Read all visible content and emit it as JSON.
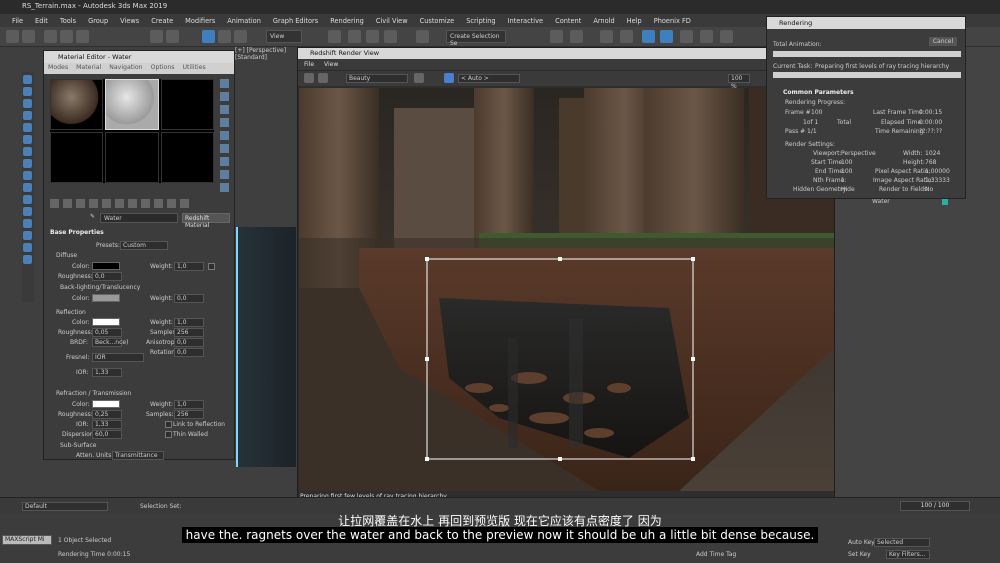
{
  "window": {
    "title": "RS_Terrain.max - Autodesk 3ds Max 2019"
  },
  "menubar": [
    "File",
    "Edit",
    "Tools",
    "Group",
    "Views",
    "Create",
    "Modifiers",
    "Animation",
    "Graph Editors",
    "Rendering",
    "Civil View",
    "Customize",
    "Scripting",
    "Interactive",
    "Content",
    "Arnold",
    "Help",
    "Phoenix FD"
  ],
  "toolbar": {
    "view_dropdown": "View",
    "selection_set": "Create Selection Se"
  },
  "viewport": {
    "label": "[+] [Perspective] [Standard]"
  },
  "material_editor": {
    "title": "Material Editor - Water",
    "menu": [
      "Modes",
      "Material",
      "Navigation",
      "Options",
      "Utilities"
    ],
    "material_name": "Water",
    "material_type": "Redshift Material",
    "base_properties": {
      "header": "Base Properties",
      "preset_label": "Presets:",
      "preset_value": "Custom",
      "diffuse": "Diffuse",
      "color_label": "Color:",
      "weight_label": "Weight:",
      "diffuse_weight": "1,0",
      "roughness_label": "Roughness:",
      "diffuse_roughness": "0,0",
      "backlighting": "Back-lighting/Translucency",
      "back_weight": "0,0",
      "reflection": "Reflection",
      "refl_roughness": "0,05",
      "samples_label": "Samples:",
      "refl_samples": "256",
      "brdf_label": "BRDF:",
      "brdf_value": "Beck...nce)",
      "anisotropy_label": "Anisotropy:",
      "anisotropy": "0,0",
      "rotation_label": "Rotation:",
      "rotation": "0,0",
      "fresnel_label": "Fresnel:",
      "fresnel_value": "IOR",
      "ior_label": "IOR:",
      "ior": "1,33",
      "refraction": "Refraction / Transmission",
      "refr_weight": "1,0",
      "refr_roughness": "0,25",
      "refr_samples": "256",
      "refr_ior": "1,33",
      "link_reflection": "Link to Reflection",
      "dispersion_label": "Dispersion:",
      "dispersion": "60,0",
      "thin_walled": "Thin Walled",
      "subsurface": "Sub-Surface",
      "atten_label": "Atten. Units:",
      "atten_value": "Transmittance"
    }
  },
  "render_view": {
    "title": "Redshift Render View",
    "menu": [
      "File",
      "View"
    ],
    "aov": "Beauty",
    "camera": "< Auto >",
    "zoom": "100 %",
    "status": "Preparing first few levels of ray tracing hierarchy"
  },
  "rendering_dialog": {
    "title": "Rendering",
    "cancel": "Cancel",
    "total_animation": "Total Animation:",
    "current_task_label": "Current Task:",
    "current_task": "Preparing first levels of ray tracing hierarchy",
    "common_parameters": "Common Parameters",
    "rendering_progress": "Rendering Progress:",
    "frame_label": "Frame #",
    "frame": "100",
    "of": "1of 1",
    "total": "Total",
    "pass_label": "Pass #",
    "pass": "1/1",
    "last_frame_time_label": "Last Frame Time:",
    "last_frame_time": "0:00:15",
    "elapsed_label": "Elapsed Time:",
    "elapsed": "0:00:00",
    "remaining_label": "Time Remaining:",
    "remaining": "??:??:??",
    "render_settings": "Render Settings:",
    "viewport_label": "Viewport:",
    "viewport": "Perspective",
    "start_label": "Start Time:",
    "start": "100",
    "end_label": "End Time:",
    "end": "100",
    "nth_label": "Nth Frame:",
    "nth": "1",
    "hidden_label": "Hidden Geometry:",
    "hidden": "Hide",
    "width_label": "Width:",
    "width": "1024",
    "height_label": "Height:",
    "height": "768",
    "pixel_aspect_label": "Pixel Aspect Ratio:",
    "pixel_aspect": "1,00000",
    "image_aspect_label": "Image Aspect Ratio:",
    "image_aspect": "1,33333",
    "fields_label": "Render to Fields:",
    "fields": "No"
  },
  "right_panel": {
    "material": "Water"
  },
  "timeline": {
    "layer": "Default",
    "selection_set": "Selection Set:",
    "frame_counter": "100 / 100"
  },
  "status": {
    "maxscript": "MAXScript Mi",
    "objects": "1 Object Selected",
    "rendering_time": "Rendering Time  0:00:15",
    "add_time_tag": "Add Time Tag",
    "auto_key": "Auto Key",
    "selected": "Selected",
    "set_key": "Set Key",
    "key_filters": "Key Filters..."
  },
  "subtitles": {
    "cn": "让拉网覆盖在水上 再回到预览版 现在它应该有点密度了 因为",
    "en": "have the. ragnets over the water and back to the preview now it should be uh a little bit dense because."
  }
}
